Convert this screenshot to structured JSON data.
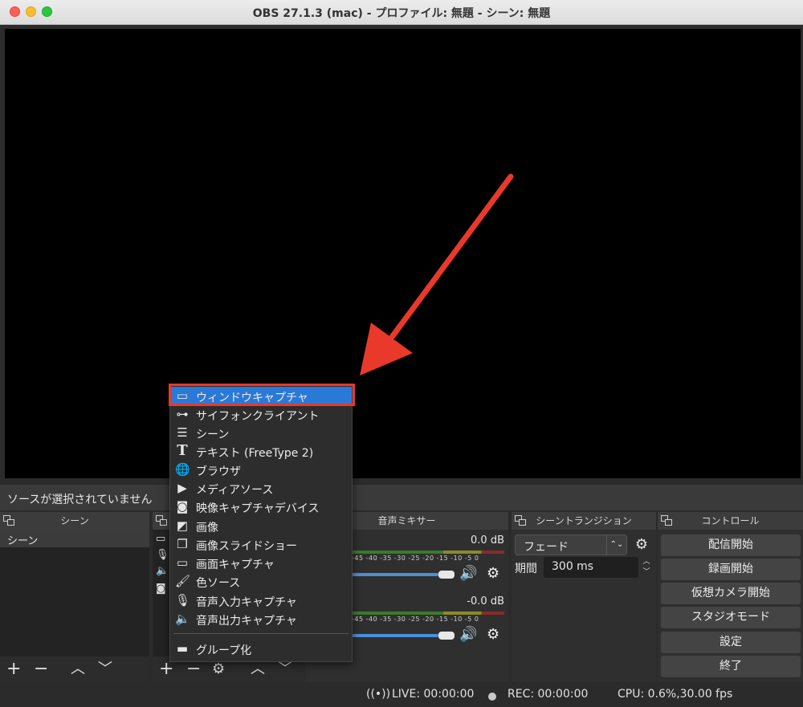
{
  "window": {
    "title": "OBS 27.1.3 (mac) - プロファイル: 無題 - シーン: 無題"
  },
  "source_status": "ソースが選択されていません",
  "docks": {
    "scenes": {
      "title": "シーン",
      "items": [
        "シーン"
      ]
    },
    "mixer": {
      "title": "音声ミキサー",
      "channels": [
        {
          "db": "0.0 dB"
        },
        {
          "db": "-0.0 dB"
        }
      ],
      "ticks": "-45 -40 -35 -30 -25 -20 -15 -10 -5 0"
    },
    "transitions": {
      "title": "シーントランジション",
      "selected": "フェード",
      "duration_label": "期間",
      "duration_value": "300 ms"
    },
    "controls": {
      "title": "コントロール",
      "buttons": [
        "配信開始",
        "録画開始",
        "仮想カメラ開始",
        "スタジオモード",
        "設定",
        "終了"
      ]
    }
  },
  "context_menu": {
    "items": [
      {
        "label": "ウィンドウキャプチャ",
        "icon": "window-icon"
      },
      {
        "label": "サイフォンクライアント",
        "icon": "gamepad-icon"
      },
      {
        "label": "シーン",
        "icon": "list-icon"
      },
      {
        "label": "テキスト (FreeType 2)",
        "icon": "text-icon"
      },
      {
        "label": "ブラウザ",
        "icon": "globe-icon"
      },
      {
        "label": "メディアソース",
        "icon": "play-icon"
      },
      {
        "label": "映像キャプチャデバイス",
        "icon": "camera-icon"
      },
      {
        "label": "画像",
        "icon": "image-icon"
      },
      {
        "label": "画像スライドショー",
        "icon": "slideshow-icon"
      },
      {
        "label": "画面キャプチャ",
        "icon": "monitor-icon"
      },
      {
        "label": "色ソース",
        "icon": "brush-icon"
      },
      {
        "label": "音声入力キャプチャ",
        "icon": "microphone-icon"
      },
      {
        "label": "音声出力キャプチャ",
        "icon": "speaker-icon"
      },
      {
        "label": "グループ化",
        "icon": "folder-icon"
      }
    ]
  },
  "statusbar": {
    "live": "LIVE: 00:00:00",
    "rec": "REC: 00:00:00",
    "cpu": "CPU: 0.6%,30.00 fps"
  },
  "colors": {
    "selection": "#2b79d6",
    "annotation": "#e8392a",
    "slider": "#4a8fd8"
  }
}
